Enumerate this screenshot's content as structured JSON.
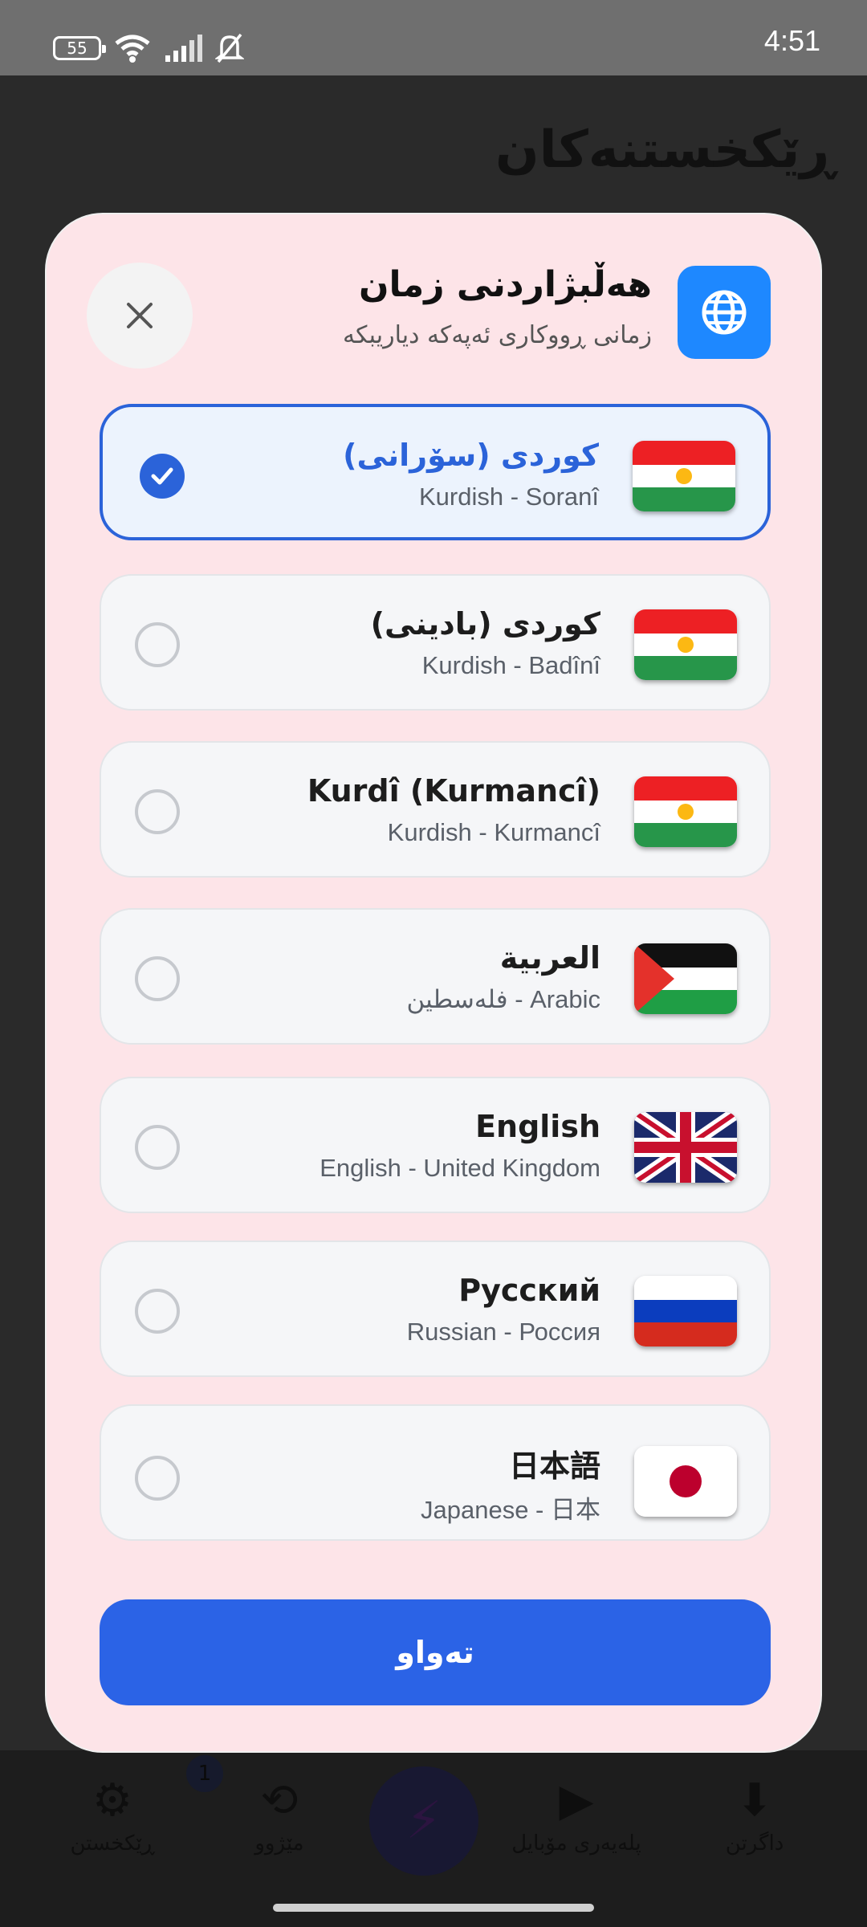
{
  "status_bar": {
    "battery": "55",
    "time": "4:51"
  },
  "background": {
    "page_title": "ڕێکخستنەکان",
    "nav": {
      "settings_label": "ڕێکخستن",
      "history_label": "مێژوو",
      "badge_count": "1",
      "playlist_label": "پلەیەری مۆبایل",
      "download_label": "داگرتن"
    }
  },
  "dialog": {
    "title": "هەڵبژاردنی زمان",
    "subtitle": "زمانی ڕووکاری ئەپەکە دیاریبکە",
    "languages": [
      {
        "name": "كوردی (سۆرانی)",
        "sub": "Kurdish - Soranî",
        "flag": "kurdistan",
        "selected": true
      },
      {
        "name": "كوردی (بادینی)",
        "sub": "Kurdish - Badînî",
        "flag": "kurdistan",
        "selected": false
      },
      {
        "name": "Kurdî (Kurmancî)",
        "sub": "Kurdish - Kurmancî",
        "flag": "kurdistan",
        "selected": false
      },
      {
        "name": "العربية",
        "sub": "فلەسطین - Arabic",
        "flag": "palestine",
        "selected": false
      },
      {
        "name": "English",
        "sub": "English - United Kingdom",
        "flag": "uk",
        "selected": false
      },
      {
        "name": "Русский",
        "sub": "Russian - Россия",
        "flag": "russia",
        "selected": false
      },
      {
        "name": "日本語",
        "sub": "Japanese - 日本",
        "flag": "japan",
        "selected": false
      }
    ],
    "done_label": "تەواو"
  },
  "colors": {
    "accent": "#2b63d9",
    "dialog_bg": "#fde4e8",
    "globe_bg": "#1e88ff"
  }
}
